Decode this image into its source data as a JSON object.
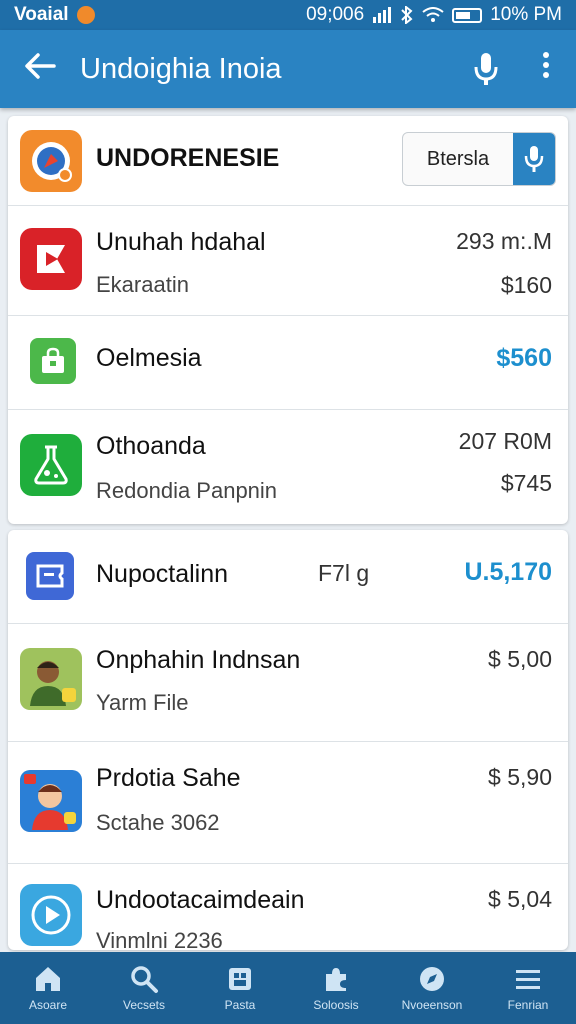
{
  "status_bar": {
    "carrier": "Voaial",
    "time": "09;006",
    "battery": "10% PM"
  },
  "app_bar": {
    "title": "Undoighia Inoia",
    "back_icon": "arrow-left-icon",
    "mic_icon": "microphone-icon",
    "more_icon": "more-vertical-icon"
  },
  "list_group_1": [
    {
      "name": "UNDORENESIE",
      "button_label": "Btersla",
      "icon": "browser-icon",
      "icon_color": "#f28b2c"
    },
    {
      "name": "Unuhah hdahal",
      "sub": "Ekaraatin",
      "size": "293 m:.M",
      "price": "$160",
      "icon": "video-play-icon",
      "icon_color": "#d92228"
    },
    {
      "name": "Oelmesia",
      "price": "$560",
      "price_highlight": true,
      "icon": "bag-icon",
      "icon_color": "#4cb84a"
    },
    {
      "name": "Othoanda",
      "sub": "Redondia Panpnin",
      "size": "207 R0M",
      "price": "$745",
      "icon": "flask-icon",
      "icon_color": "#1fae3c"
    }
  ],
  "list_group_2": [
    {
      "name": "Nupoctalinn",
      "mid": "F7l g",
      "price": "U.5,170",
      "price_highlight": true,
      "icon": "ticket-icon",
      "icon_color": "#3f68d6"
    },
    {
      "name": "Onphahin Indnsan",
      "sub": "Yarm File",
      "price": "$ 5,00",
      "icon": "avatar-game-icon",
      "icon_color": "#8bc34a"
    },
    {
      "name": "Prdotia Sahe",
      "sub": "Sctahe 3062",
      "price": "$ 5,90",
      "icon": "avatar-game-icon",
      "icon_color": "#2b7fd6"
    },
    {
      "name": "Undootacaimdeain",
      "sub": "Vinmlni 2236",
      "price": "$ 5,04",
      "icon": "play-circle-icon",
      "icon_color": "#3aa7e0"
    }
  ],
  "bottom_nav": [
    {
      "label": "Asoare",
      "icon": "home-icon"
    },
    {
      "label": "Vecsets",
      "icon": "search-icon"
    },
    {
      "label": "Pasta",
      "icon": "store-icon"
    },
    {
      "label": "Soloosis",
      "icon": "puzzle-icon"
    },
    {
      "label": "Nvoeenson",
      "icon": "compass-icon"
    },
    {
      "label": "Fenrian",
      "icon": "menu-icon"
    }
  ],
  "colors": {
    "app_bar": "#2a83c2",
    "status_bar": "#1f6ea8",
    "bottom_nav": "#1c5f92",
    "highlight_price": "#1d8fce"
  }
}
